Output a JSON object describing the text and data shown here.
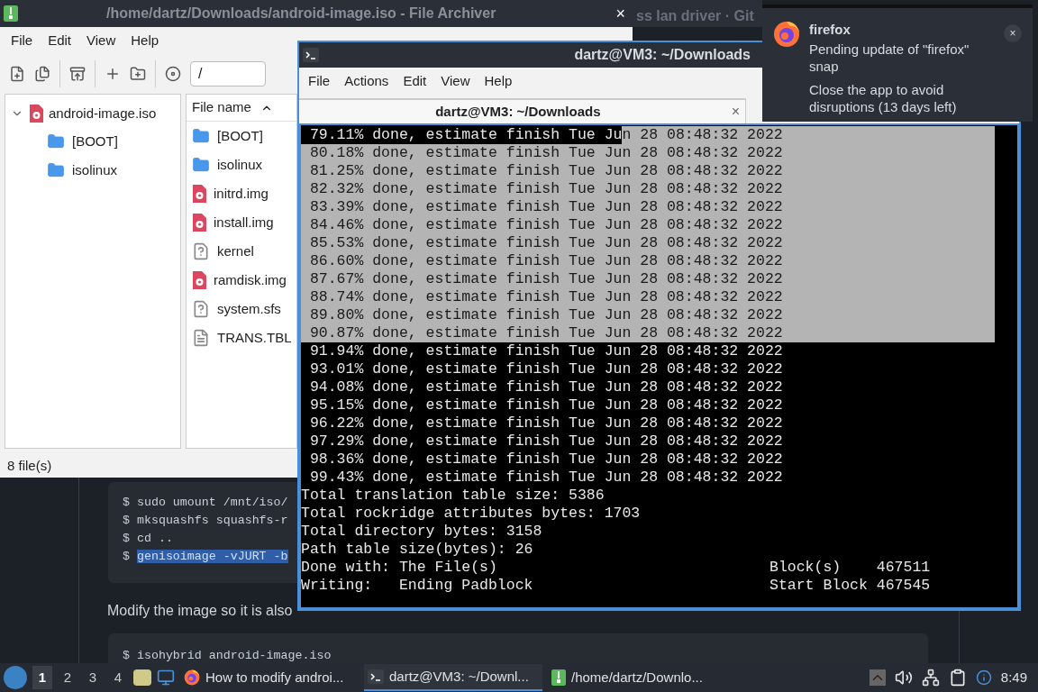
{
  "browser_behind": {
    "title_fragment": "ss lan driver · Git",
    "code_block_1": [
      "$ sudo umount /mnt/iso/",
      "$ mksquashfs squashfs-r",
      "$ cd ..",
      {
        "prompt": "$ ",
        "text": "genisoimage -vJURT -b",
        "selected": true
      }
    ],
    "paragraph": "Modify the image so it is also",
    "code_block_2": [
      "$ isohybrid android-image.iso"
    ]
  },
  "archiver": {
    "title": "/home/dartz/Downloads/android-image.iso - File Archiver",
    "close": "×",
    "menu": [
      "File",
      "Edit",
      "View",
      "Help"
    ],
    "location": "/",
    "tree": [
      {
        "label": "android-image.iso",
        "kind": "disk",
        "expanded": true,
        "children": [
          {
            "label": "[BOOT]",
            "kind": "folder"
          },
          {
            "label": "isolinux",
            "kind": "folder"
          }
        ]
      }
    ],
    "column": "File name",
    "files": [
      {
        "name": "[BOOT]",
        "kind": "folder"
      },
      {
        "name": "isolinux",
        "kind": "folder"
      },
      {
        "name": "initrd.img",
        "kind": "disk"
      },
      {
        "name": "install.img",
        "kind": "disk"
      },
      {
        "name": "kernel",
        "kind": "unknown"
      },
      {
        "name": "ramdisk.img",
        "kind": "disk"
      },
      {
        "name": "system.sfs",
        "kind": "unknown"
      },
      {
        "name": "TRANS.TBL",
        "kind": "text"
      }
    ],
    "status": "8 file(s)"
  },
  "terminal": {
    "title": "dartz@VM3: ~/Downloads",
    "menu": [
      "File",
      "Actions",
      "Edit",
      "View",
      "Help"
    ],
    "tab": {
      "label": "dartz@VM3: ~/Downloads",
      "close": "×"
    },
    "lines": [
      {
        "segments": [
          {
            "text": " 79.11% done, estimate finish Tue Ju",
            "selected": false
          },
          {
            "text": "n 28 08:48:32 2022",
            "selected": true
          }
        ]
      },
      {
        "segments": [
          {
            "text": " 80.18% done, estimate finish Tue Jun 28 08:48:32 2022",
            "selected": true
          }
        ]
      },
      {
        "segments": [
          {
            "text": " 81.25% done, estimate finish Tue Jun 28 08:48:32 2022",
            "selected": true
          }
        ]
      },
      {
        "segments": [
          {
            "text": " 82.32% done, estimate finish Tue Jun 28 08:48:32 2022",
            "selected": true
          }
        ]
      },
      {
        "segments": [
          {
            "text": " 83.39% done, estimate finish Tue Jun 28 08:48:32 2022",
            "selected": true
          }
        ]
      },
      {
        "segments": [
          {
            "text": " 84.46% done, estimate finish Tue Jun 28 08:48:32 2022",
            "selected": true
          }
        ]
      },
      {
        "segments": [
          {
            "text": " 85.53% done, estimate finish Tue Jun 28 08:48:32 2022",
            "selected": true
          }
        ]
      },
      {
        "segments": [
          {
            "text": " 86.60% done, estimate finish Tue Jun 28 08:48:32 2022",
            "selected": true
          }
        ]
      },
      {
        "segments": [
          {
            "text": " 87.67% done, estimate finish Tue Jun 28 08:48:32 2022",
            "selected": true
          }
        ]
      },
      {
        "segments": [
          {
            "text": " 88.74% done, estimate finish Tue Jun 28 08:48:32 2022",
            "selected": true
          }
        ]
      },
      {
        "segments": [
          {
            "text": " 89.80% done, estimate finish Tue Jun 28 08:48:32 2022",
            "selected": true
          }
        ]
      },
      {
        "segments": [
          {
            "text": " 90.87% done, estimate finish Tue Jun 28 08:48:32 2022",
            "selected": true
          }
        ]
      },
      {
        "segments": [
          {
            "text": " 91.94% done, estimate finish Tue Jun 28 08:48:32 2022",
            "selected": false
          }
        ]
      },
      {
        "segments": [
          {
            "text": " 93.01% done, estimate finish Tue Jun 28 08:48:32 2022",
            "selected": false
          }
        ]
      },
      {
        "segments": [
          {
            "text": " 94.08% done, estimate finish Tue Jun 28 08:48:32 2022",
            "selected": false
          }
        ]
      },
      {
        "segments": [
          {
            "text": " 95.15% done, estimate finish Tue Jun 28 08:48:32 2022",
            "selected": false
          }
        ]
      },
      {
        "segments": [
          {
            "text": " 96.22% done, estimate finish Tue Jun 28 08:48:32 2022",
            "selected": false
          }
        ]
      },
      {
        "segments": [
          {
            "text": " 97.29% done, estimate finish Tue Jun 28 08:48:32 2022",
            "selected": false
          }
        ]
      },
      {
        "segments": [
          {
            "text": " 98.36% done, estimate finish Tue Jun 28 08:48:32 2022",
            "selected": false
          }
        ]
      },
      {
        "segments": [
          {
            "text": " 99.43% done, estimate finish Tue Jun 28 08:48:32 2022",
            "selected": false
          }
        ]
      },
      {
        "segments": [
          {
            "text": "Total translation table size: 5386",
            "selected": false
          }
        ]
      },
      {
        "segments": [
          {
            "text": "Total rockridge attributes bytes: 1703",
            "selected": false
          }
        ]
      },
      {
        "segments": [
          {
            "text": "Total directory bytes: 3158",
            "selected": false
          }
        ]
      },
      {
        "segments": [
          {
            "text": "Path table size(bytes): 26",
            "selected": false
          }
        ]
      },
      {
        "segments": [
          {
            "text": "Done with: The File(s)",
            "selected": false
          }
        ],
        "right": "Block(s)    467511"
      },
      {
        "segments": [
          {
            "text": "Writing:   Ending Padblock",
            "selected": false
          }
        ],
        "right": "Start Block 467545"
      }
    ]
  },
  "notification": {
    "app": "firefox",
    "body": "Pending update of \"firefox\" snap",
    "detail": "Close the app to avoid disruptions (13 days left)",
    "close": "×"
  },
  "taskbar": {
    "workspaces": [
      {
        "label": "1",
        "selected": true
      },
      {
        "label": "2",
        "selected": false
      },
      {
        "label": "3",
        "selected": false
      },
      {
        "label": "4",
        "selected": false
      }
    ],
    "tasks": [
      {
        "label": "How to modify androi...",
        "kind": "browser",
        "selected": false
      },
      {
        "label": "dartz@VM3: ~/Downl...",
        "kind": "terminal",
        "selected": true
      },
      {
        "label": "/home/dartz/Downlo...",
        "kind": "archiver",
        "selected": false
      }
    ],
    "clock": "8:49"
  }
}
